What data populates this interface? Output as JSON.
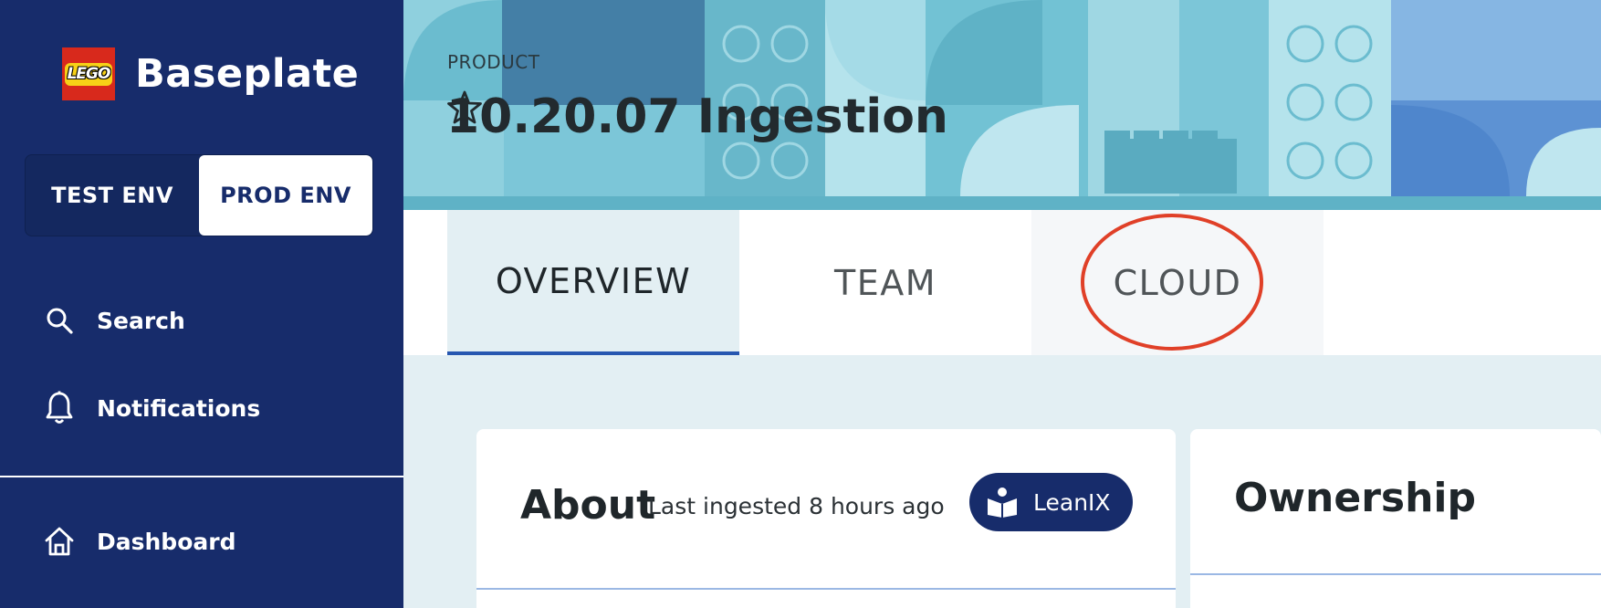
{
  "sidebar": {
    "brand": {
      "logo_text": "LEGO",
      "name": "Baseplate"
    },
    "env_toggle": {
      "test_label": "TEST ENV",
      "prod_label": "PROD ENV",
      "active": "PROD ENV"
    },
    "items": [
      {
        "label": "Search",
        "icon": "search-icon"
      },
      {
        "label": "Notifications",
        "icon": "bell-icon"
      },
      {
        "label": "Dashboard",
        "icon": "home-icon"
      }
    ]
  },
  "header": {
    "eyebrow": "PRODUCT",
    "title": "10.20.07 Ingestion",
    "favorite_icon": "star-outline-icon"
  },
  "tabs": [
    {
      "label": "OVERVIEW",
      "active": true
    },
    {
      "label": "TEAM",
      "active": false
    },
    {
      "label": "CLOUD",
      "active": false,
      "highlighted": true
    }
  ],
  "about_card": {
    "title": "About",
    "last_ingested": "Last ingested 8 hours ago",
    "source_badge": {
      "label": "LeanIX",
      "icon": "leanix-book-icon"
    }
  },
  "ownership_card": {
    "title": "Ownership"
  },
  "colors": {
    "sidebar_bg": "#172c6b",
    "accent_blue": "#2757b0",
    "highlight_red": "#e04028",
    "content_bg": "#e3eff3"
  }
}
